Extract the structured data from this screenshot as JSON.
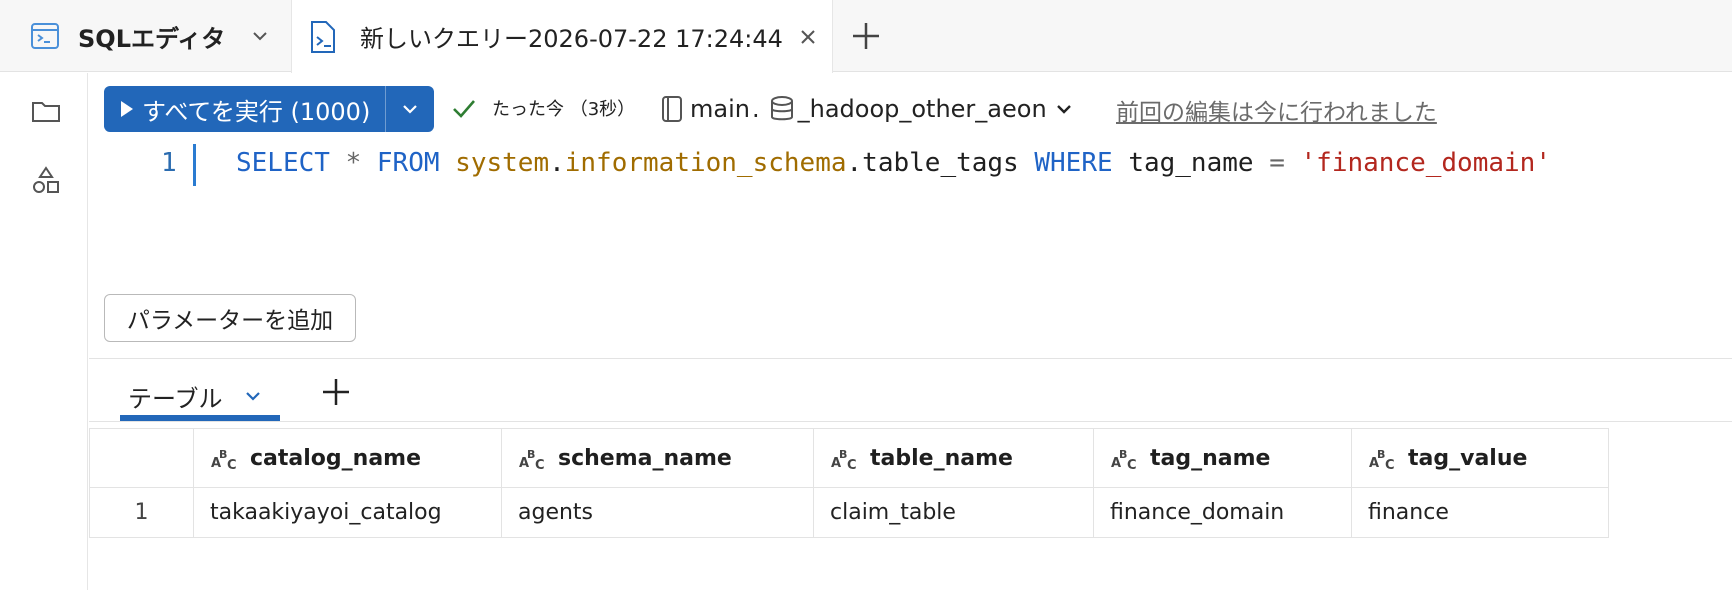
{
  "tabbar": {
    "app_label": "SQLエディタ",
    "query_tab_label": "新しいクエリー2026-07-22 17:24:44",
    "icons": {
      "app": "sql-editor-icon",
      "query": "query-file-icon",
      "close": "close-icon",
      "add": "plus-icon"
    }
  },
  "toolbar": {
    "run_label": "すべてを実行 (1000)",
    "status_text": "たった今 （3秒）",
    "catalog": "main",
    "separator": ".",
    "schema": "_hadoop_other_aeon",
    "last_edit": "前回の編集は今に行われました"
  },
  "editor": {
    "line_number": "1",
    "tokens": {
      "select": "SELECT",
      "star": "*",
      "from": "FROM",
      "t1": "system",
      "dot1": ".",
      "t2": "information_schema",
      "dot2": ".",
      "t3": "table_tags",
      "where": "WHERE",
      "col": "tag_name",
      "eq": "=",
      "val": "'finance_domain'"
    }
  },
  "params": {
    "add_label": "パラメーターを追加"
  },
  "results": {
    "tab_label": "テーブル",
    "columns": [
      "catalog_name",
      "schema_name",
      "table_name",
      "tag_name",
      "tag_value"
    ],
    "rows": [
      {
        "n": "1",
        "cells": [
          "takaakiyayoi_catalog",
          "agents",
          "claim_table",
          "finance_domain",
          "finance"
        ]
      }
    ]
  },
  "colors": {
    "accent": "#2267b9",
    "keyword": "#1f63c6",
    "identifier": "#a06c00",
    "string": "#b3271e",
    "success": "#2e7d32"
  }
}
